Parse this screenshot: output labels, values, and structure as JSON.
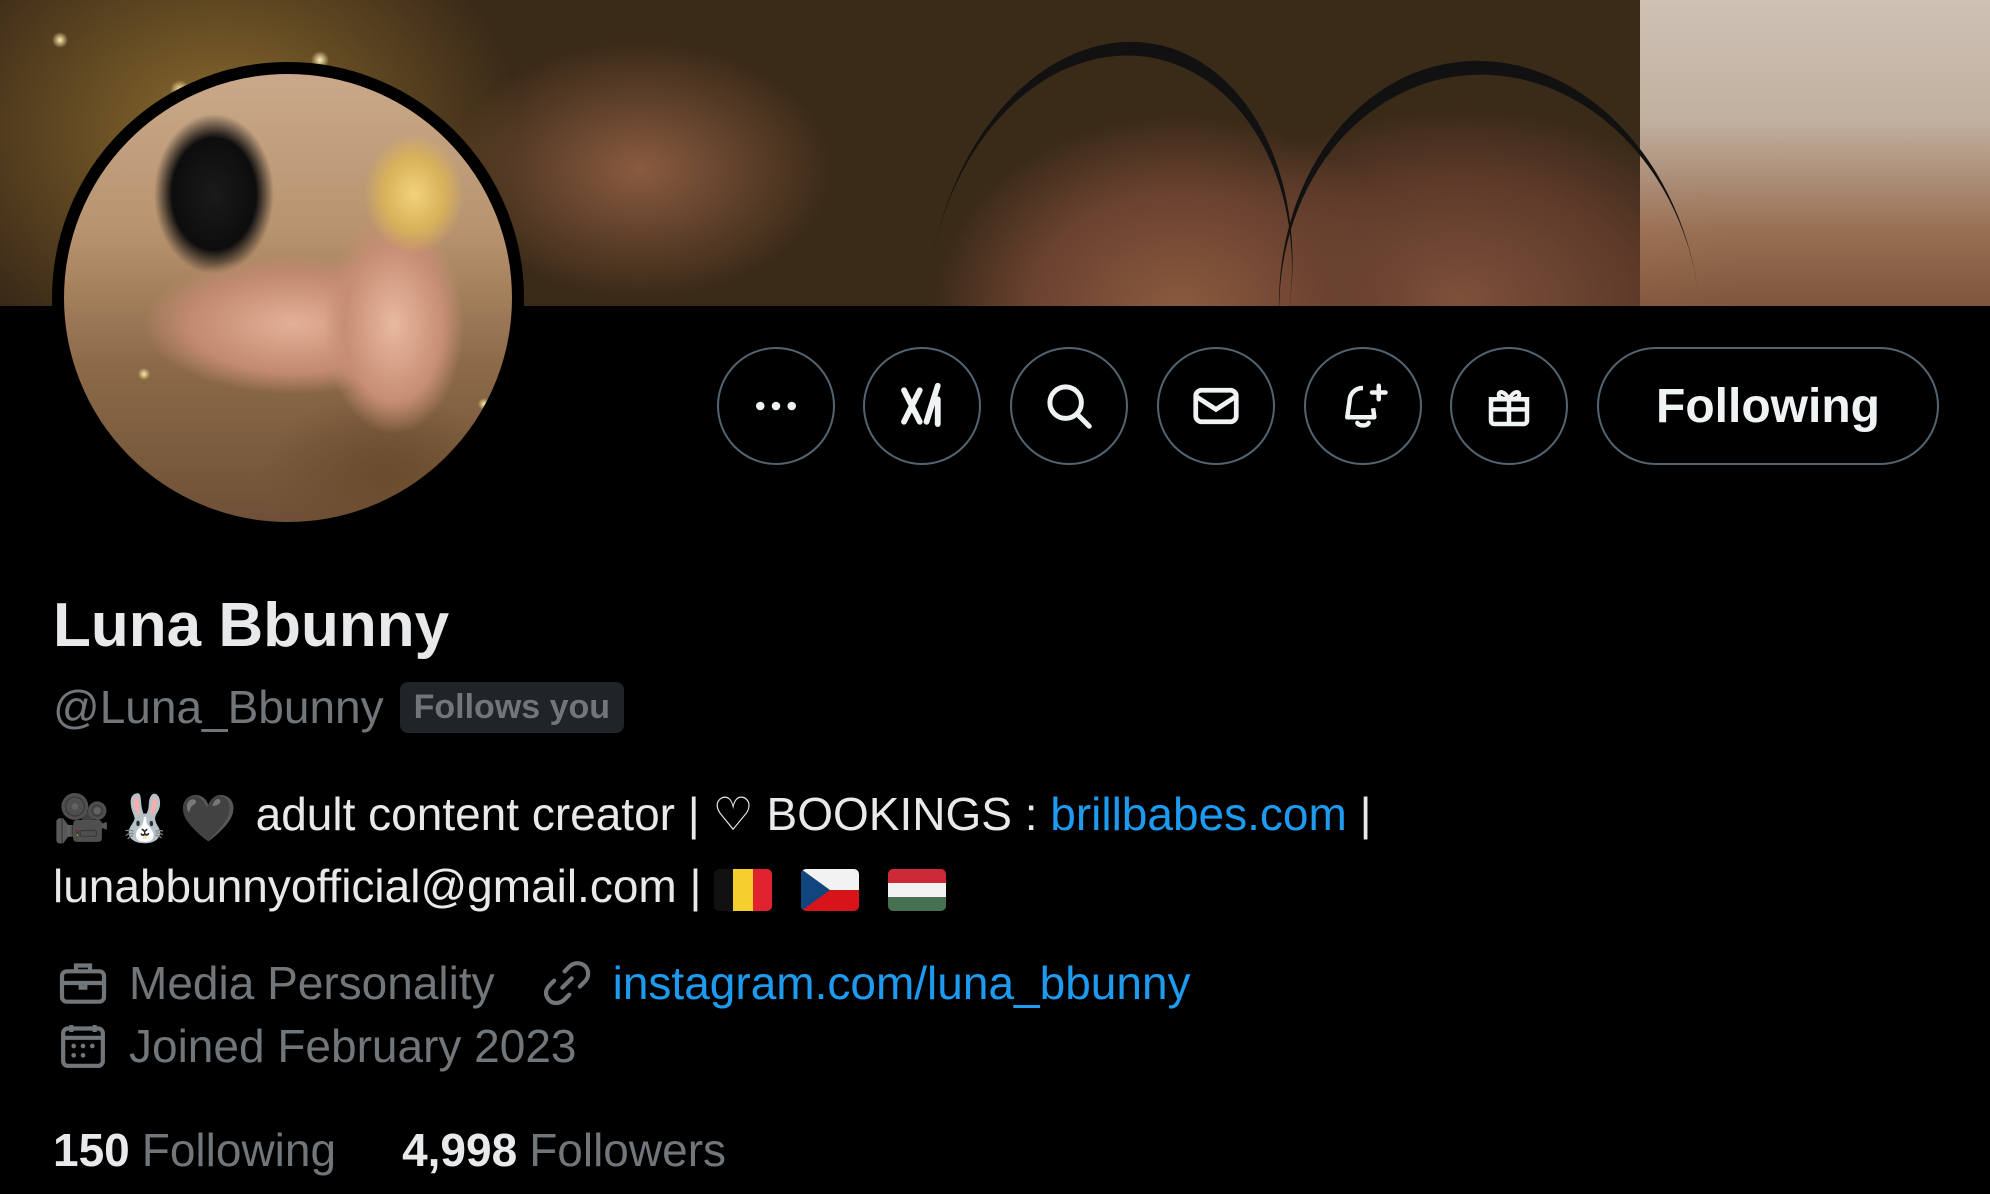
{
  "profile": {
    "display_name": "Luna Bbunny",
    "handle": "@Luna_Bbunny",
    "follows_you_badge": "Follows you"
  },
  "actions": {
    "more_icon": "more-horizontal-icon",
    "grok_icon": "grok-icon",
    "search_icon": "search-icon",
    "message_icon": "envelope-icon",
    "notify_icon": "bell-plus-icon",
    "gift_icon": "gift-icon",
    "following_label": "Following"
  },
  "bio": {
    "emojis": [
      "🎥",
      "🐰",
      "🖤"
    ],
    "text_1": "adult content creator | ♡ BOOKINGS : ",
    "link": "brillbabes.com",
    "text_2": " |",
    "text_3": "lunabbunnyofficial@gmail.com | ",
    "flags": [
      "belgium-flag",
      "czech-flag",
      "hungary-flag"
    ]
  },
  "meta": {
    "category": "Media Personality",
    "website": "instagram.com/luna_bbunny",
    "joined": "Joined February 2023"
  },
  "stats": {
    "following_count": "150",
    "following_label": "Following",
    "followers_count": "4,998",
    "followers_label": "Followers"
  },
  "colors": {
    "background": "#000000",
    "text_primary": "#e7e9ea",
    "text_secondary": "#71767b",
    "link": "#1d9bf0",
    "border": "#536471"
  }
}
